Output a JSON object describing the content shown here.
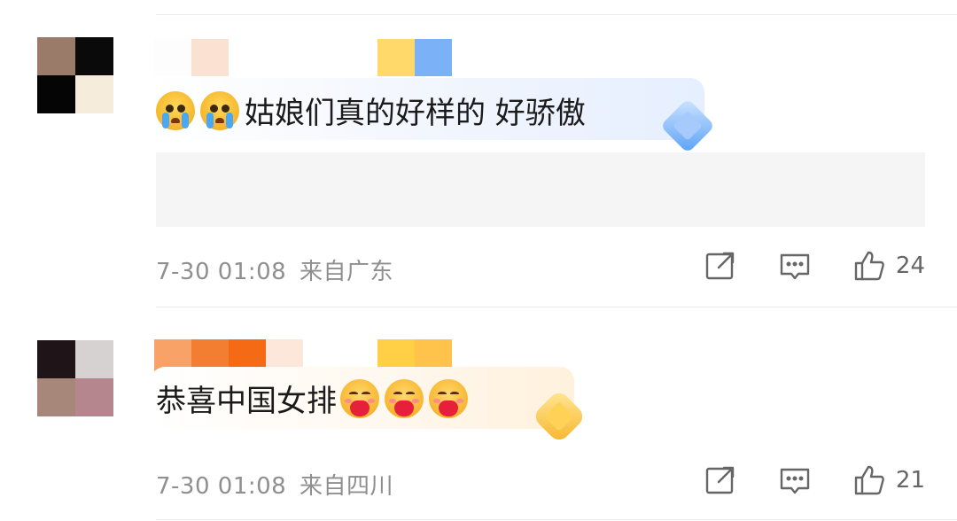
{
  "comments": [
    {
      "text": "姑娘们真的好样的 好骄傲",
      "emojis": [
        "crying-emoji",
        "crying-emoji"
      ],
      "emoji_position": "before",
      "time": "7-30 01:08",
      "location": "来自广东",
      "likes": "24",
      "badge_color": "#5aa2f5"
    },
    {
      "text": "恭喜中国女排",
      "emojis": [
        "hug-heart-emoji",
        "hug-heart-emoji",
        "hug-heart-emoji"
      ],
      "emoji_position": "after",
      "time": "7-30 01:08",
      "location": "来自四川",
      "likes": "21",
      "badge_color": "#f7b52a"
    }
  ],
  "icons": {
    "share": "share-icon",
    "comment": "comment-icon",
    "like": "thumbs-up-icon"
  }
}
